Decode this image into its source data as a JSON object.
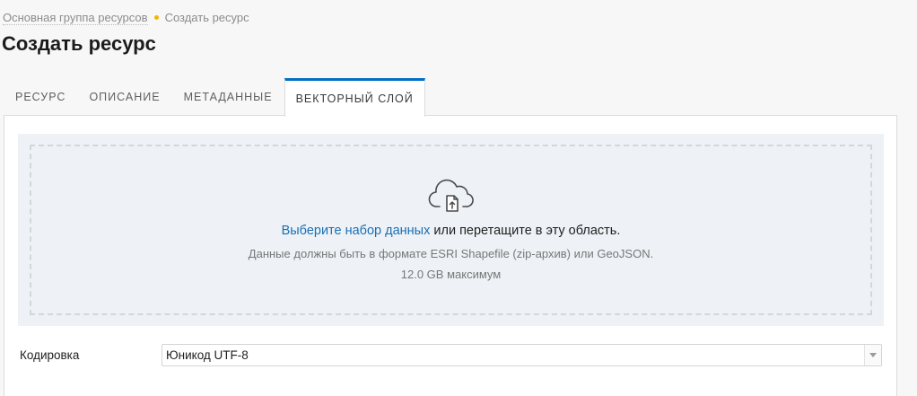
{
  "breadcrumb": {
    "parent": "Основная группа ресурсов",
    "current": "Создать ресурс"
  },
  "page_title": "Создать ресурс",
  "tabs": [
    {
      "label": "РЕСУРС",
      "active": false
    },
    {
      "label": "ОПИСАНИЕ",
      "active": false
    },
    {
      "label": "МЕТАДАННЫЕ",
      "active": false
    },
    {
      "label": "ВЕКТОРНЫЙ СЛОЙ",
      "active": true
    }
  ],
  "upload": {
    "icon": "cloud-upload-icon",
    "select_link": "Выберите набор данных",
    "drop_text": " или перетащите в эту область.",
    "format_hint": "Данные должны быть в формате ESRI Shapefile (zip-архив) или GeoJSON.",
    "max_size": "12.0 GB максимум"
  },
  "encoding": {
    "label": "Кодировка",
    "value": "Юникод UTF-8"
  },
  "colors": {
    "accent": "#0070c5",
    "link": "#1a6fb5",
    "breadcrumb_separator": "#f5b400",
    "upload_background": "#eef2f6"
  }
}
